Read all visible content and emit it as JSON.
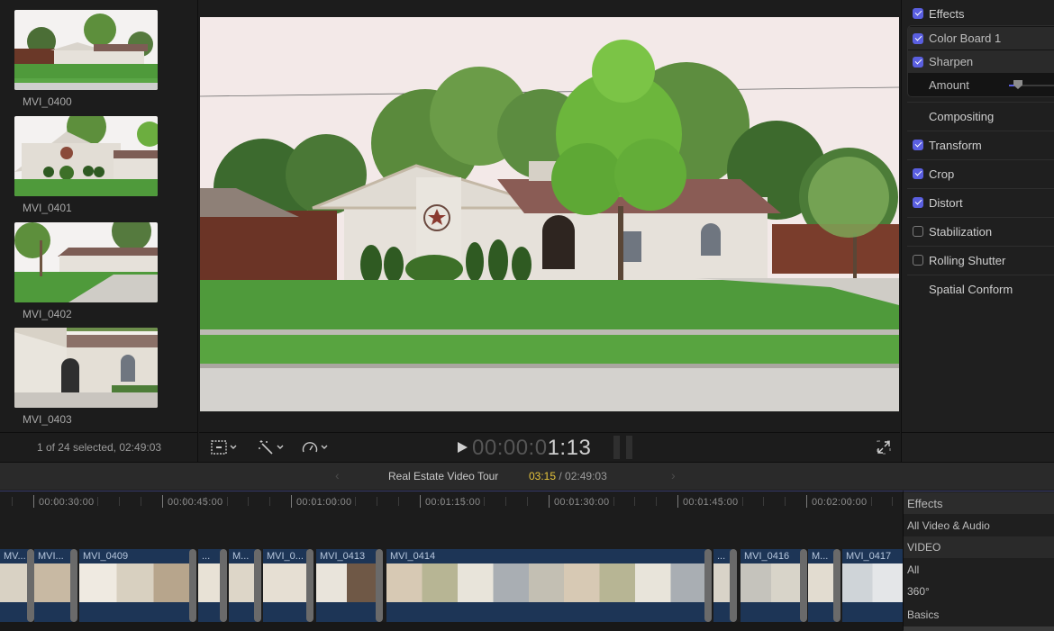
{
  "browser": {
    "clips": [
      {
        "name": "MVI_0400"
      },
      {
        "name": "MVI_0401"
      },
      {
        "name": "MVI_0402"
      },
      {
        "name": "MVI_0403"
      }
    ],
    "status": "1 of 24 selected, 02:49:03"
  },
  "viewer": {
    "timecode_dim": "00:00:0",
    "timecode_bright": "1:13",
    "tools": [
      {
        "icon": "transform-crop-icon"
      },
      {
        "icon": "magic-wand-icon"
      },
      {
        "icon": "speedometer-retime-icon"
      }
    ]
  },
  "inspector": {
    "effects_label": "Effects",
    "effects_checked": true,
    "effects": [
      {
        "label": "Color Board 1",
        "checked": true
      },
      {
        "label": "Sharpen",
        "checked": true
      }
    ],
    "amount_label": "Amount",
    "amount_value": 0.05,
    "sections": [
      {
        "label": "Compositing",
        "checkbox": false,
        "checked": false
      },
      {
        "label": "Transform",
        "checkbox": true,
        "checked": true
      },
      {
        "label": "Crop",
        "checkbox": true,
        "checked": true
      },
      {
        "label": "Distort",
        "checkbox": true,
        "checked": true
      },
      {
        "label": "Stabilization",
        "checkbox": true,
        "checked": false
      },
      {
        "label": "Rolling Shutter",
        "checkbox": true,
        "checked": false
      },
      {
        "label": "Spatial Conform",
        "checkbox": false,
        "checked": false
      }
    ]
  },
  "timeline": {
    "project_name": "Real Estate Video Tour",
    "current_position": "03:15",
    "separator": " / ",
    "duration": "02:49:03",
    "ruler_labels": [
      "00:00:30:00",
      "00:00:45:00",
      "00:01:00:00",
      "00:01:15:00",
      "00:01:30:00",
      "00:01:45:00",
      "00:02:00:00"
    ],
    "clips": [
      {
        "label": "MV..."
      },
      {
        "label": "MVI..."
      },
      {
        "label": "MVI_0409"
      },
      {
        "label": "..."
      },
      {
        "label": "M..."
      },
      {
        "label": "MVI_0..."
      },
      {
        "label": "MVI_0413"
      },
      {
        "label": "MVI_0414"
      },
      {
        "label": "..."
      },
      {
        "label": "MVI_0416"
      },
      {
        "label": "M..."
      },
      {
        "label": "MVI_0417"
      }
    ]
  },
  "effects_browser": {
    "title": "Effects",
    "items": [
      {
        "label": "All Video & Audio",
        "type": "item"
      },
      {
        "label": "VIDEO",
        "type": "section"
      },
      {
        "label": "All",
        "type": "item"
      },
      {
        "label": "360°",
        "type": "item"
      },
      {
        "label": "Basics",
        "type": "item"
      }
    ]
  },
  "colors": {
    "accent": "#5a5fe0",
    "playhead_time": "#e6c43b",
    "clip_blue": "#1d3556"
  }
}
